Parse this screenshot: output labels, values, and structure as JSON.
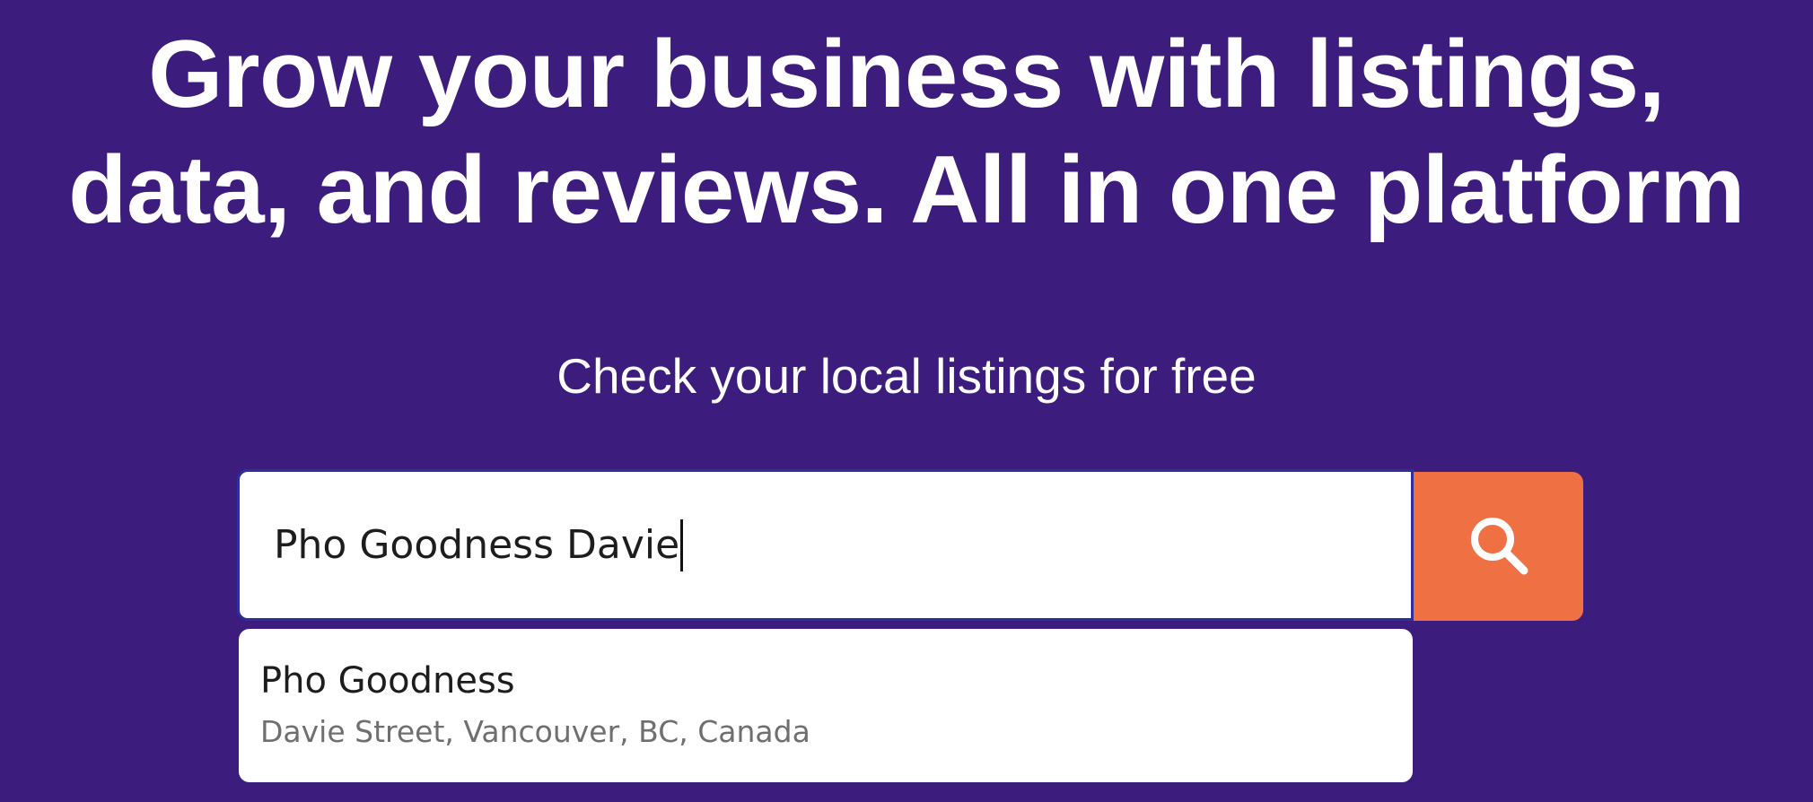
{
  "hero": {
    "title_line_1": "Grow your business with listings,",
    "title_line_2": "data, and reviews. All in one platform",
    "subtitle": "Check your local listings for free"
  },
  "search": {
    "value": "Pho Goodness Davie",
    "button_icon": "search-icon"
  },
  "suggestions": [
    {
      "name": "Pho Goodness",
      "address": "Davie Street, Vancouver, BC, Canada"
    }
  ],
  "colors": {
    "background": "#3c1c7c",
    "accent": "#ee7043",
    "input_border": "#2f2f9c",
    "text_dark": "#1d1d1d",
    "text_muted": "#6f6f6f"
  }
}
